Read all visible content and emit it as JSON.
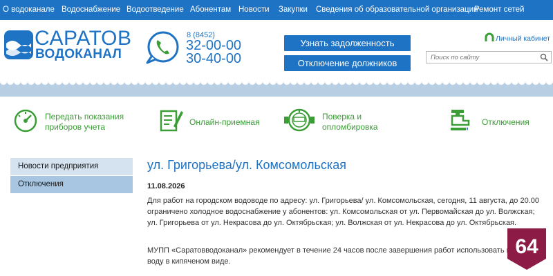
{
  "nav": [
    "О водоканале",
    "Водоснабжение",
    "Водоотведение",
    "Абонентам",
    "Новости",
    "Закупки",
    "Сведения об образовательной организации",
    "Ремонт сетей"
  ],
  "logo": {
    "line1": "САРАТОВ",
    "line2": "ВОДОКАНАЛ"
  },
  "phone": {
    "code": "8 (8452)",
    "num1": "32-00-00",
    "num2": "30-40-00"
  },
  "buttons": {
    "debt": "Узнать задолженность",
    "disconnect": "Отключение должников"
  },
  "cabinet": "Личный кабинет",
  "search": {
    "placeholder": "Поиск по сайту"
  },
  "features": [
    {
      "line1": "Передать показания",
      "line2": "приборов учета",
      "icon": "gauge-icon"
    },
    {
      "line1": "Онлайн-приемная",
      "line2": "",
      "icon": "document-pen-icon"
    },
    {
      "line1": "Поверка и",
      "line2": "опломбировка",
      "icon": "water-meter-icon"
    },
    {
      "line1": "Отключения",
      "line2": "",
      "icon": "faucet-icon"
    }
  ],
  "sidebar": [
    "Новости предприятия",
    "Отключения"
  ],
  "article": {
    "title": "ул. Григорьева/ул. Комсомольская",
    "date": "11.08.2026",
    "p1": "Для работ на городском водоводе по адресу: ул. Григорьева/ ул. Комсомольская, сегодня, 11 августа, до 20.00 ограничено холодное водоснабжение у абонентов: ул. Комсомольская от ул. Первомайская до ул. Волжская; ул. Григорьева от ул. Некрасова до ул. Октябрьская; ул. Волжская от ул. Некрасова до ул. Октябрьская.",
    "p2": "МУПП «Саратовводоканал» рекомендует в течение 24 часов после завершения работ использовать питьевую воду в кипяченом виде."
  },
  "badge": "64",
  "colors": {
    "brand": "#1f73c4",
    "green": "#3a9d35",
    "badge": "#8c1b45"
  }
}
